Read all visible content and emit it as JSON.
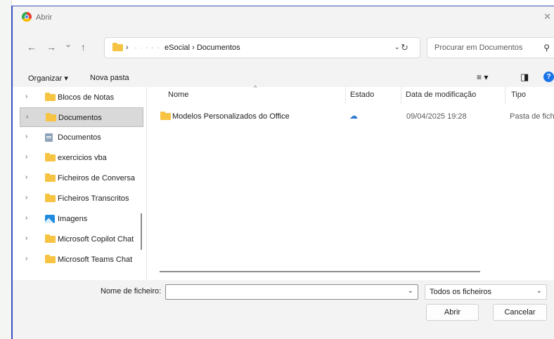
{
  "window": {
    "title": "Abrir",
    "close_glyph": "✕"
  },
  "nav": {
    "back_glyph": "←",
    "forward_glyph": "→",
    "history_glyph": "⌄",
    "up_glyph": "↑",
    "address": {
      "chevron": "›",
      "obscured": "· · - - -",
      "path": "eSocial  ›  Documentos",
      "dropdown_glyph": "⌄"
    },
    "refresh_glyph": "↻",
    "search_placeholder": "Procurar em Documentos",
    "search_glyph": "⚲"
  },
  "toolbar": {
    "organize": "Organizar ▾",
    "new_folder": "Nova pasta",
    "view_glyph": "≡ ▾",
    "pane_glyph": "◨",
    "help_glyph": "?"
  },
  "sidebar": {
    "items": [
      {
        "label": "Blocos de Notas",
        "icon": "folder-icon"
      },
      {
        "label": "Documentos",
        "icon": "folder-icon",
        "selected": true
      },
      {
        "label": "Documentos",
        "icon": "document-icon"
      },
      {
        "label": "exercicios vba",
        "icon": "folder-icon"
      },
      {
        "label": "Ficheiros de Conversa",
        "icon": "folder-icon"
      },
      {
        "label": "Ficheiros Transcritos",
        "icon": "folder-icon"
      },
      {
        "label": "Imagens",
        "icon": "image-icon"
      },
      {
        "label": "Microsoft Copilot Chat",
        "icon": "folder-icon"
      },
      {
        "label": "Microsoft Teams Chat",
        "icon": "folder-icon"
      }
    ],
    "chevron": "›"
  },
  "columns": [
    "Nome",
    "Estado",
    "Data de modificação",
    "Tipo"
  ],
  "sort_glyph": "^",
  "files": [
    {
      "name": "Modelos Personalizados do Office",
      "status_glyph": "☁",
      "date": "09/04/2025 19:28",
      "type": "Pasta de ficheiros"
    }
  ],
  "footer": {
    "filename_label": "Nome de ficheiro:",
    "filename_value": "",
    "filetype": "Todos os ficheiros",
    "open": "Abrir",
    "cancel": "Cancelar",
    "dropdown_glyph": "⌄"
  },
  "colors": {
    "accent": "#3a4fbf",
    "folder": "#f6c342",
    "selection": "#d9d9d9",
    "help": "#1a73e8"
  }
}
